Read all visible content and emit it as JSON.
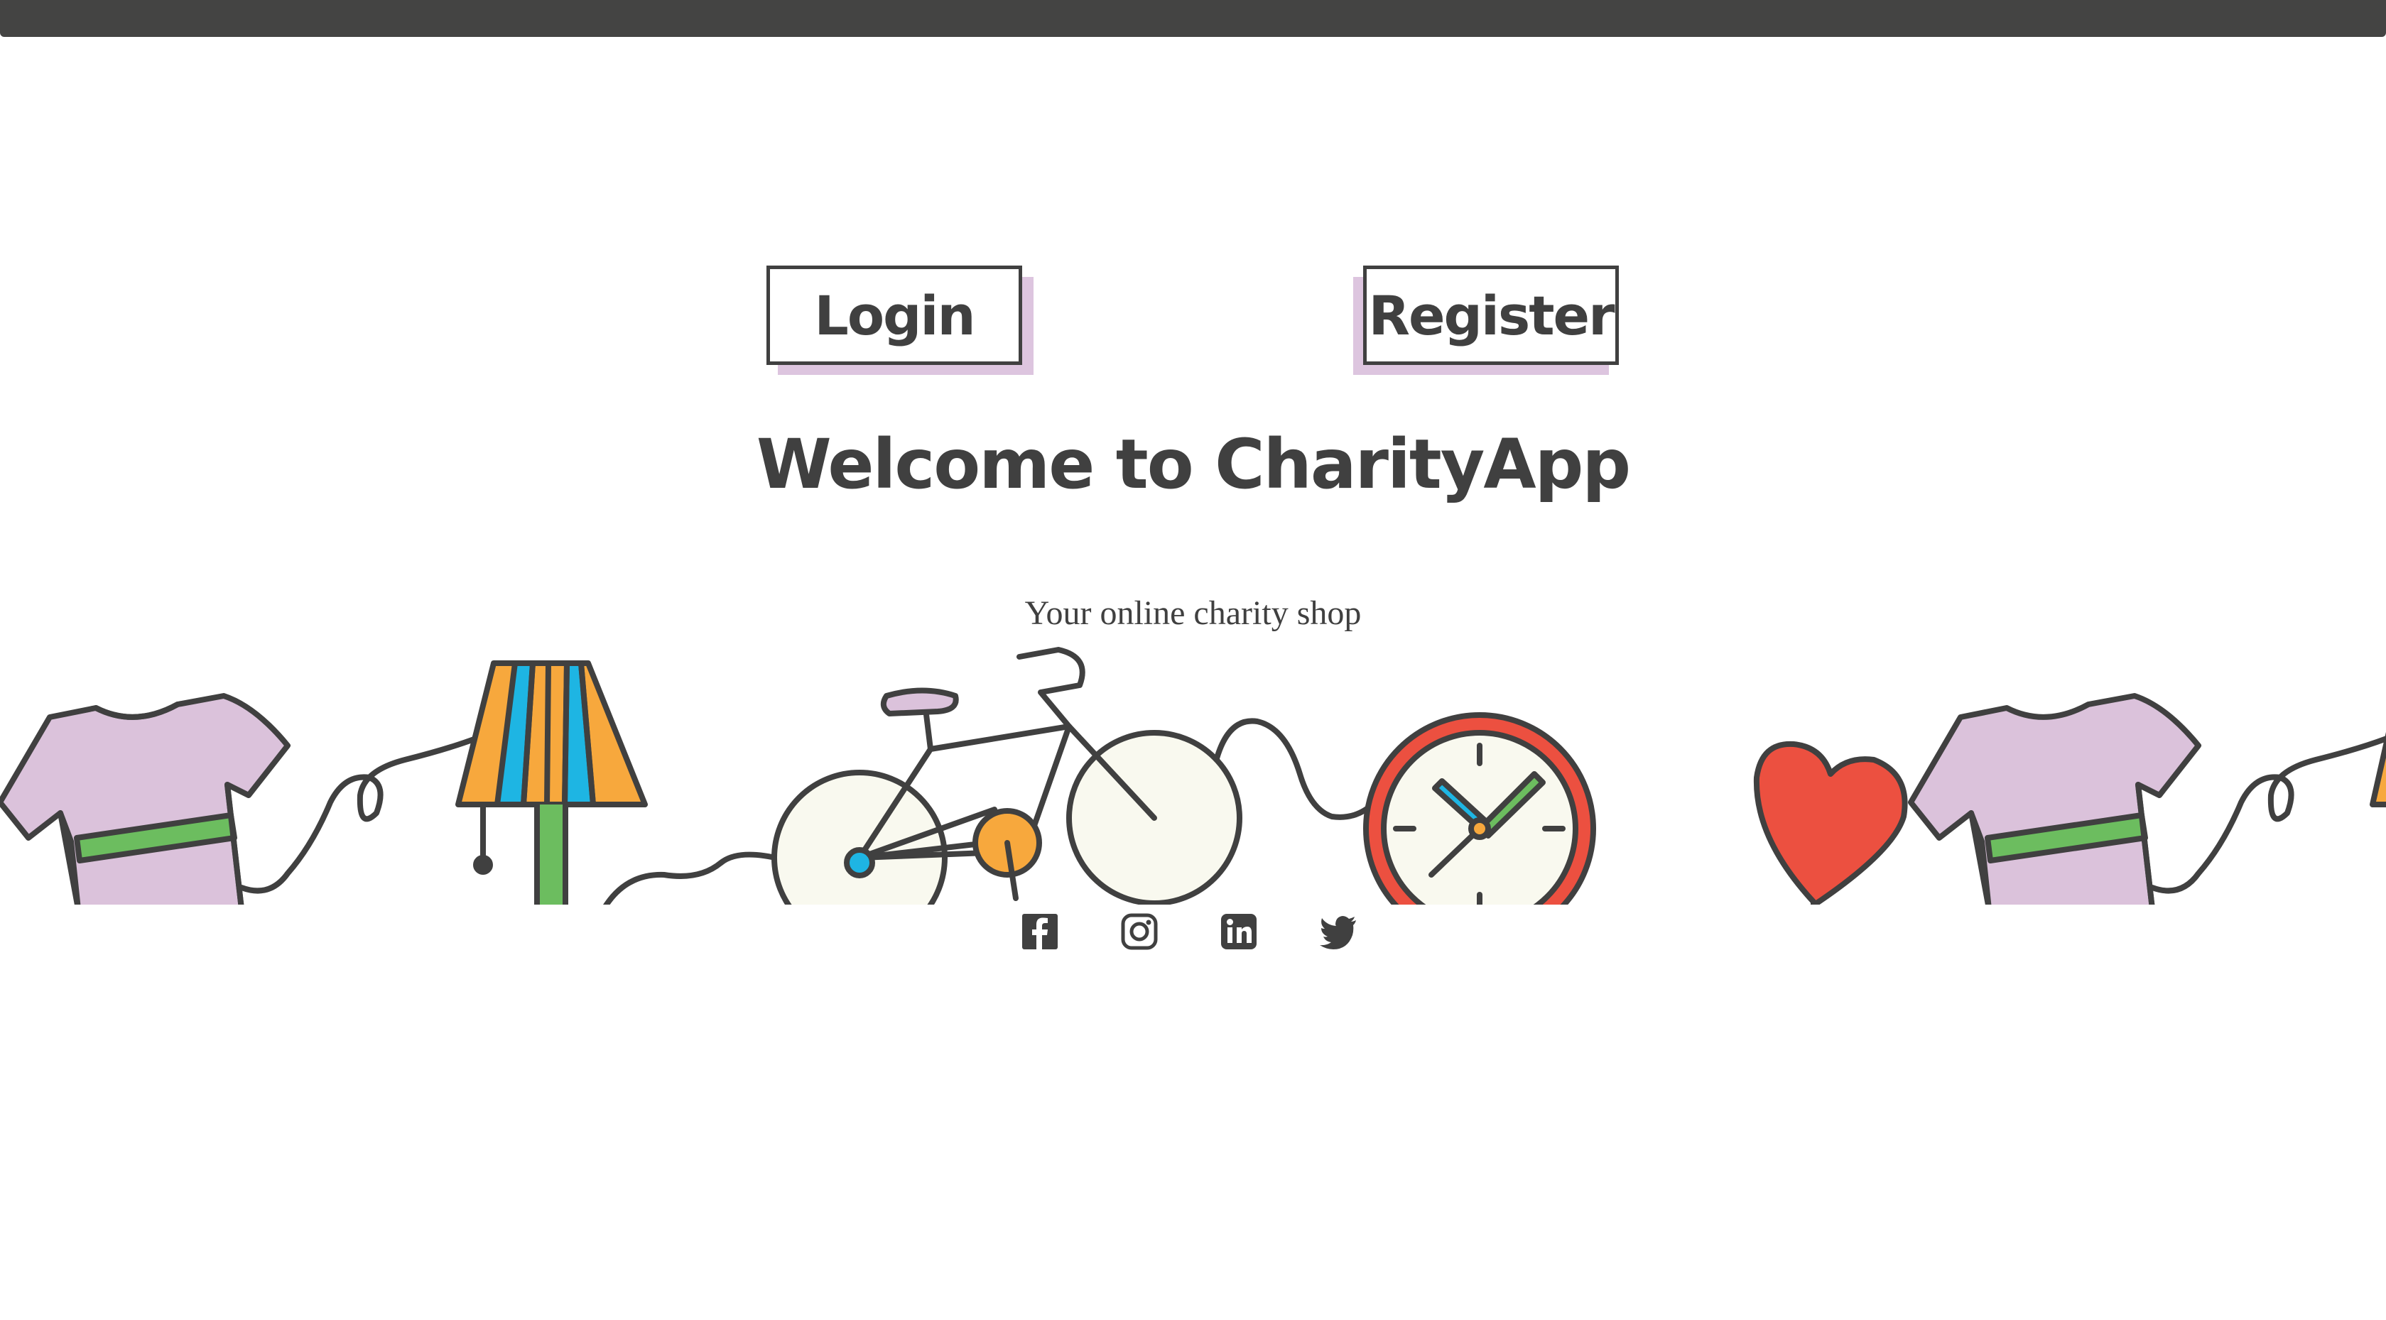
{
  "header": {
    "bar_color": "#444443"
  },
  "auth": {
    "login_label": "Login",
    "register_label": "Register",
    "shadow_color": "#ddc5df"
  },
  "hero": {
    "title": "Welcome to CharityApp",
    "tagline": "Your online charity shop"
  },
  "illustration": {
    "items": [
      "tshirt-icon",
      "lamp-icon",
      "bicycle-icon",
      "clock-icon",
      "heart-icon",
      "tshirt-icon"
    ],
    "colors": {
      "outline": "#404040",
      "lilac": "#dbc2db",
      "green": "#6cbd5f",
      "orange": "#f7a83d",
      "blue": "#1eb5e3",
      "red": "#ec5040",
      "cream": "#f9f9ef"
    }
  },
  "social": [
    {
      "icon": "facebook-icon"
    },
    {
      "icon": "instagram-icon"
    },
    {
      "icon": "linkedin-icon"
    },
    {
      "icon": "twitter-icon"
    }
  ]
}
